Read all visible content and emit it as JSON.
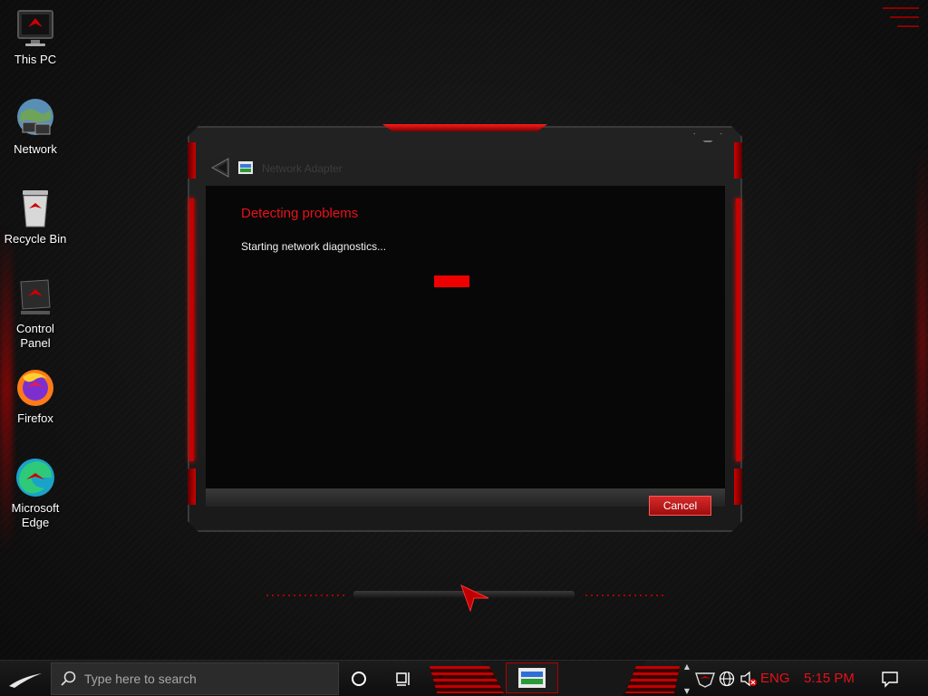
{
  "desktop": {
    "icons": [
      {
        "label": "This PC",
        "icon": "this-pc-icon"
      },
      {
        "label": "Network",
        "icon": "network-icon"
      },
      {
        "label": "Recycle Bin",
        "icon": "recycle-bin-icon"
      },
      {
        "label": "Control Panel",
        "icon": "control-panel-icon"
      },
      {
        "label": "Firefox",
        "icon": "firefox-icon"
      },
      {
        "label": "Microsoft Edge",
        "icon": "edge-icon"
      }
    ]
  },
  "dialog": {
    "title": "Network Adapter",
    "heading": "Detecting problems",
    "status": "Starting network diagnostics...",
    "progress": "indeterminate",
    "cancel_label": "Cancel"
  },
  "taskbar": {
    "search_placeholder": "Type here to search",
    "language": "ENG",
    "time": "5:15 PM"
  },
  "colors": {
    "accent": "#e8101a",
    "progress": "#ee0000",
    "button": "#c01818"
  }
}
